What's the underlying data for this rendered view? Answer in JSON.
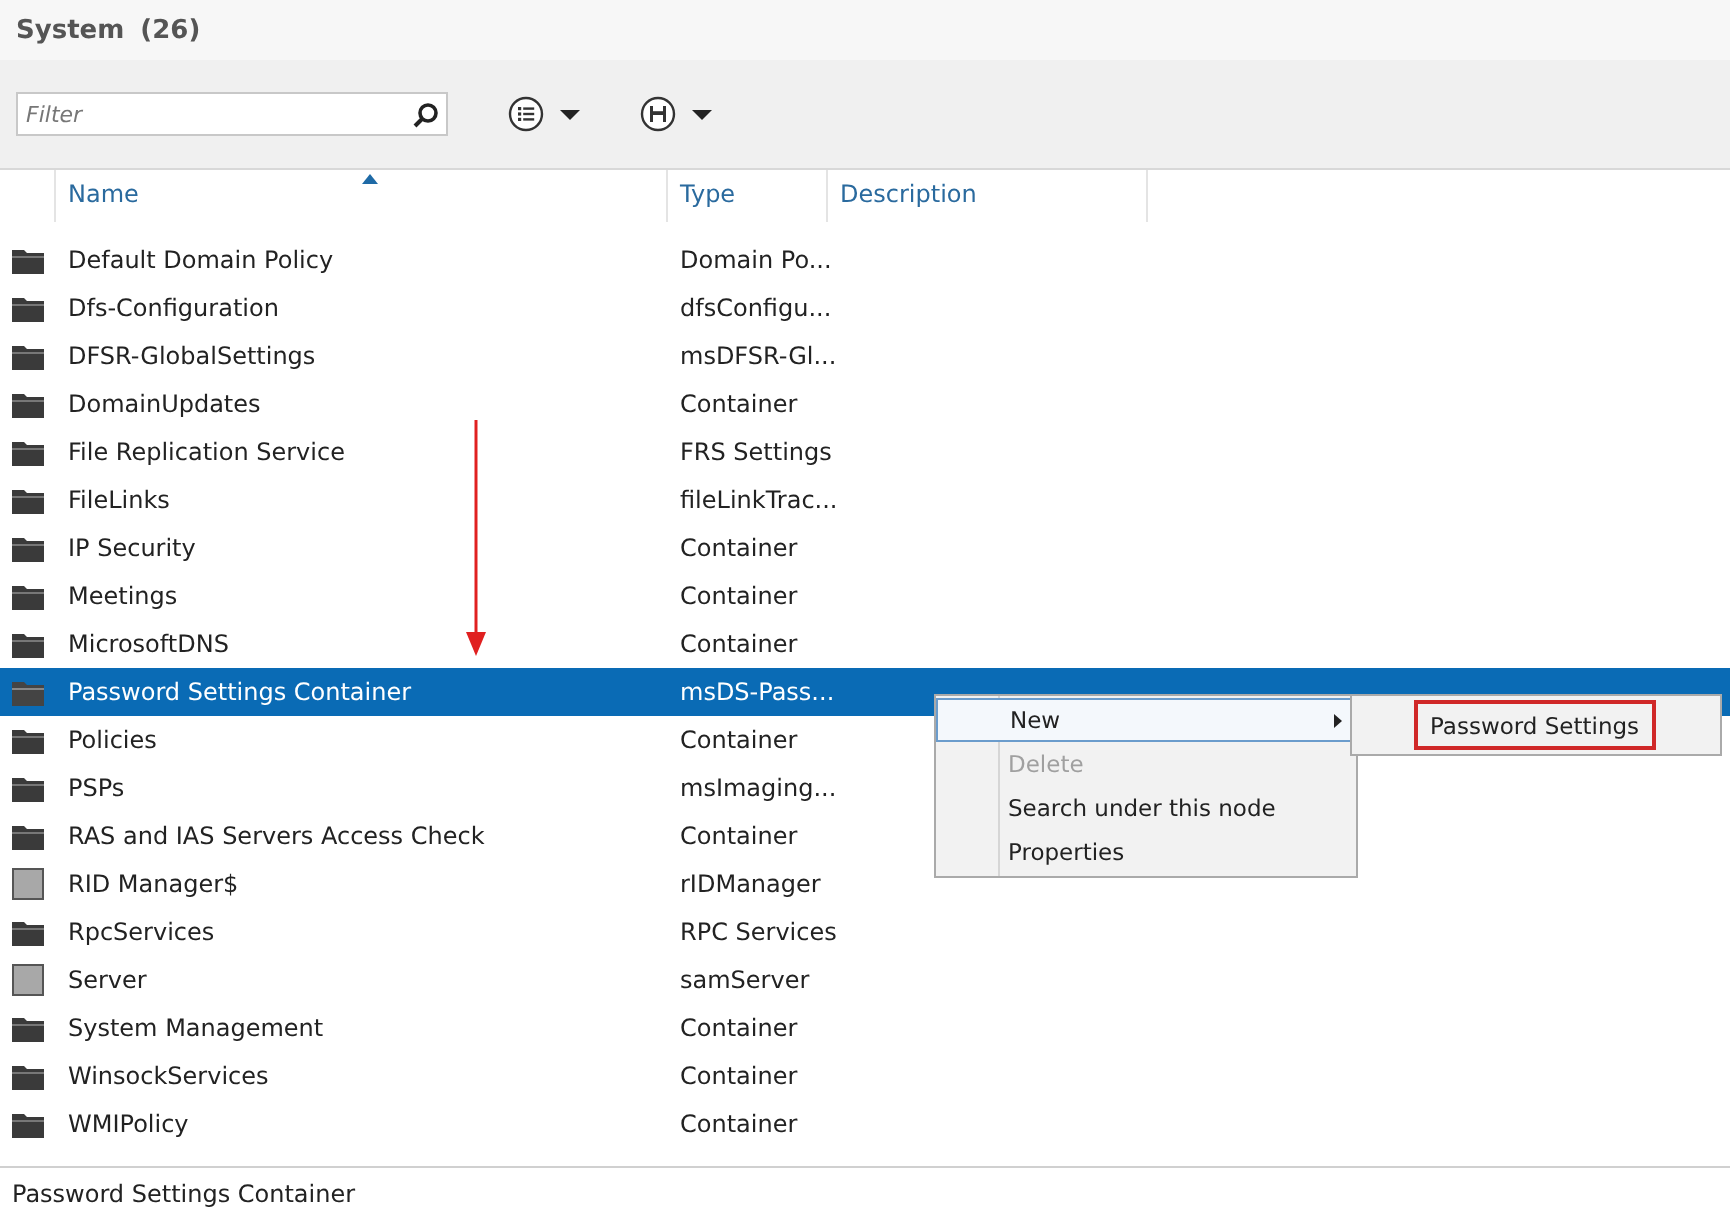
{
  "header": {
    "title": "System",
    "count": "(26)"
  },
  "toolbar": {
    "filter": {
      "placeholder": "Filter"
    }
  },
  "table": {
    "columns": [
      {
        "label": "Name",
        "sorted": true
      },
      {
        "label": "Type",
        "sorted": false
      },
      {
        "label": "Description",
        "sorted": false
      }
    ],
    "rows": [
      {
        "kind": "folder",
        "name": "Default Domain Policy",
        "type": "Domain Po...",
        "selected": false
      },
      {
        "kind": "folder",
        "name": "Dfs-Configuration",
        "type": "dfsConfigu...",
        "selected": false
      },
      {
        "kind": "folder",
        "name": "DFSR-GlobalSettings",
        "type": "msDFSR-Gl...",
        "selected": false
      },
      {
        "kind": "folder",
        "name": "DomainUpdates",
        "type": "Container",
        "selected": false
      },
      {
        "kind": "folder",
        "name": "File Replication Service",
        "type": "FRS Settings",
        "selected": false
      },
      {
        "kind": "folder",
        "name": "FileLinks",
        "type": "fileLinkTrac...",
        "selected": false
      },
      {
        "kind": "folder",
        "name": "IP Security",
        "type": "Container",
        "selected": false
      },
      {
        "kind": "folder",
        "name": "Meetings",
        "type": "Container",
        "selected": false
      },
      {
        "kind": "folder",
        "name": "MicrosoftDNS",
        "type": "Container",
        "selected": false
      },
      {
        "kind": "folder",
        "name": "Password Settings Container",
        "type": "msDS-Pass...",
        "selected": true
      },
      {
        "kind": "folder",
        "name": "Policies",
        "type": "Container",
        "selected": false
      },
      {
        "kind": "folder",
        "name": "PSPs",
        "type": "msImaging...",
        "selected": false
      },
      {
        "kind": "folder",
        "name": "RAS and IAS Servers Access Check",
        "type": "Container",
        "selected": false
      },
      {
        "kind": "object",
        "name": "RID Manager$",
        "type": "rIDManager",
        "selected": false
      },
      {
        "kind": "folder",
        "name": "RpcServices",
        "type": "RPC Services",
        "selected": false
      },
      {
        "kind": "object",
        "name": "Server",
        "type": "samServer",
        "selected": false
      },
      {
        "kind": "folder",
        "name": "System Management",
        "type": "Container",
        "selected": false
      },
      {
        "kind": "folder",
        "name": "WinsockServices",
        "type": "Container",
        "selected": false
      },
      {
        "kind": "folder",
        "name": "WMIPolicy",
        "type": "Container",
        "selected": false
      }
    ]
  },
  "context_menu": {
    "items": [
      {
        "label": "New",
        "disabled": false,
        "highlighted": true,
        "submenu": true
      },
      {
        "label": "Delete",
        "disabled": true,
        "highlighted": false,
        "submenu": false
      },
      {
        "label": "Search under this node",
        "disabled": false,
        "highlighted": false,
        "submenu": false
      },
      {
        "label": "Properties",
        "disabled": false,
        "highlighted": false,
        "submenu": false
      }
    ],
    "submenu_items": [
      {
        "label": "Password Settings",
        "highlighted": true
      }
    ]
  },
  "status_bar": {
    "text": "Password Settings Container"
  }
}
